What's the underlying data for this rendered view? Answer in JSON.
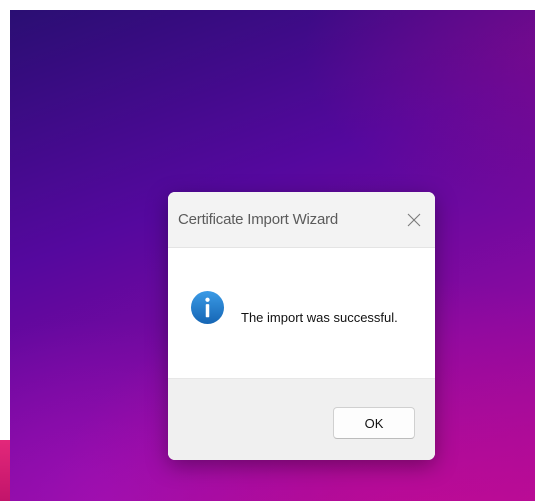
{
  "dialog": {
    "title": "Certificate Import Wizard",
    "message": "The import was successful.",
    "ok_label": "OK",
    "close_icon": "close-icon",
    "message_icon": "info-icon"
  },
  "colors": {
    "info_icon": "#1a78c2",
    "accent_background": "#55089e"
  }
}
